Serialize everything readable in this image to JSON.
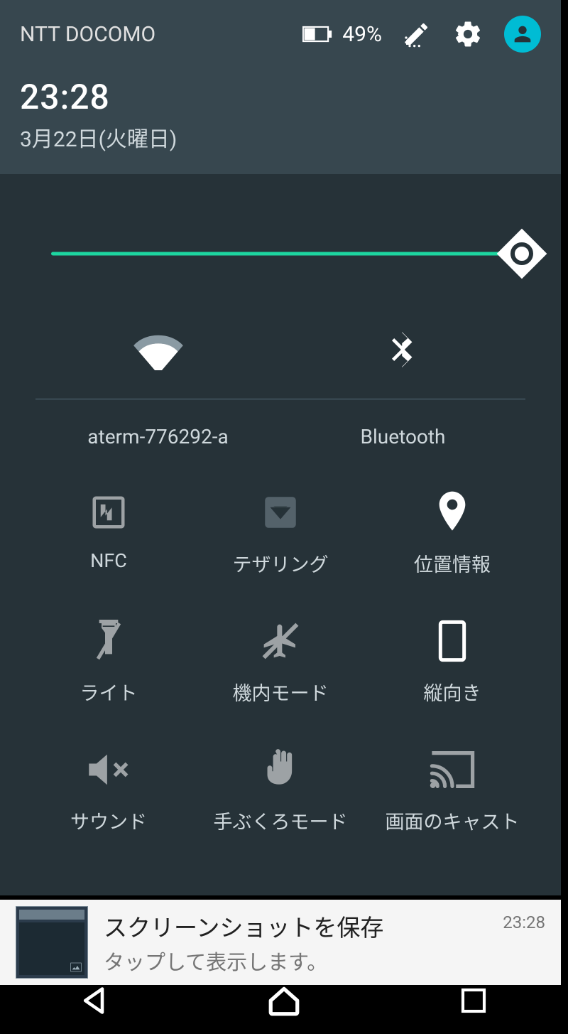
{
  "header": {
    "carrier": "NTT DOCOMO",
    "battery_pct": "49%",
    "time": "23:28",
    "date": "3月22日(火曜日)"
  },
  "brightness": {
    "level": 100
  },
  "tiles": {
    "wifi": {
      "label": "aterm-776292-a",
      "icon": "wifi-icon"
    },
    "bluetooth": {
      "label": "Bluetooth",
      "icon": "bluetooth-icon"
    },
    "nfc": {
      "label": "NFC",
      "icon": "nfc-icon"
    },
    "tether": {
      "label": "テザリング",
      "icon": "tethering-icon"
    },
    "location": {
      "label": "位置情報",
      "icon": "location-icon"
    },
    "flashlight": {
      "label": "ライト",
      "icon": "flashlight-icon"
    },
    "airplane": {
      "label": "機内モード",
      "icon": "airplane-icon"
    },
    "portrait": {
      "label": "縦向き",
      "icon": "portrait-icon"
    },
    "sound": {
      "label": "サウンド",
      "icon": "sound-mute-icon"
    },
    "glove": {
      "label": "手ぶくろモード",
      "icon": "glove-icon"
    },
    "cast": {
      "label": "画面のキャスト",
      "icon": "cast-icon"
    }
  },
  "notification": {
    "title": "スクリーンショットを保存",
    "subtitle": "タップして表示します。",
    "time": "23:28"
  },
  "colors": {
    "accent": "#00bcd4",
    "slider": "#1dd6a0"
  }
}
